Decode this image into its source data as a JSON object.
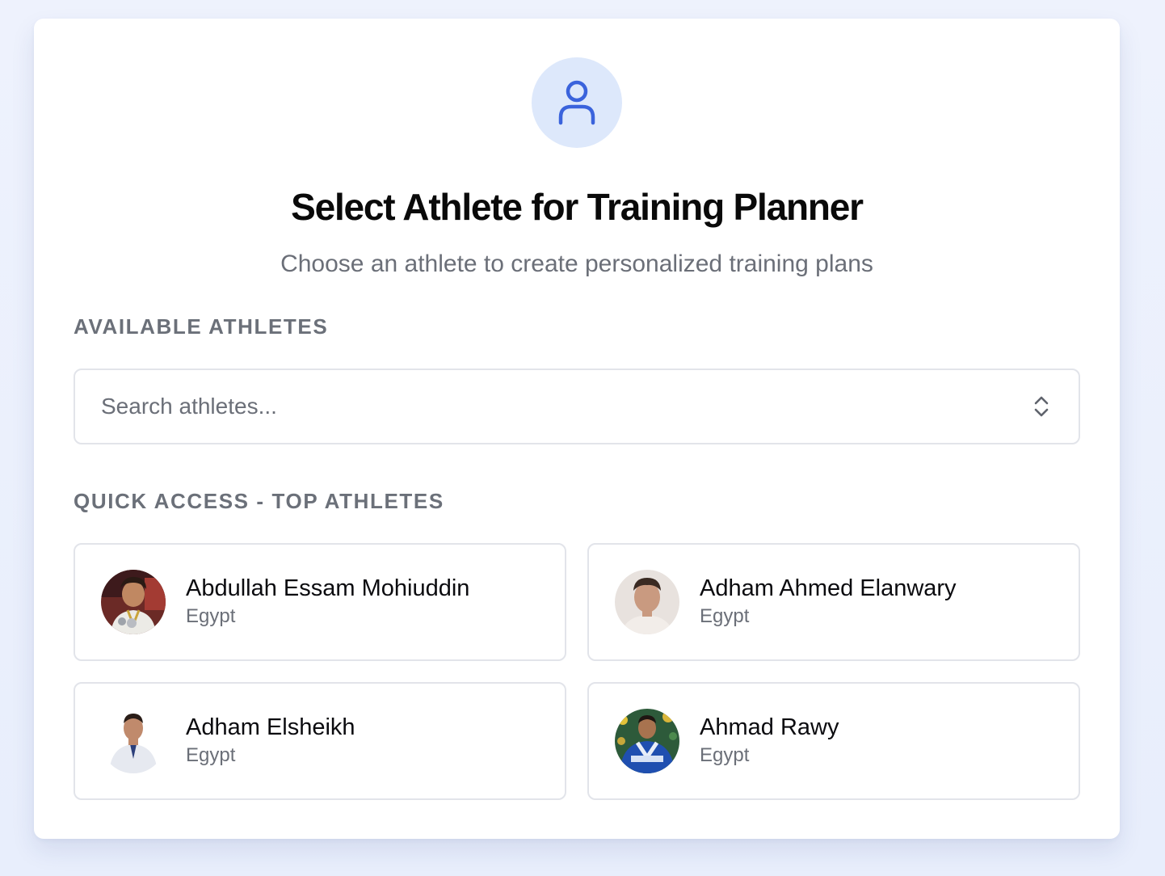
{
  "header": {
    "icon": "user-icon",
    "title": "Select Athlete for Training Planner",
    "subtitle": "Choose an athlete to create personalized training plans"
  },
  "available": {
    "label": "AVAILABLE ATHLETES",
    "search_placeholder": "Search athletes...",
    "search_value": ""
  },
  "quick_access": {
    "label": "QUICK ACCESS - TOP ATHLETES",
    "athletes": [
      {
        "name": "Abdullah Essam Mohiuddin",
        "country": "Egypt"
      },
      {
        "name": "Adham Ahmed Elanwary",
        "country": "Egypt"
      },
      {
        "name": "Adham Elsheikh",
        "country": "Egypt"
      },
      {
        "name": "Ahmad Rawy",
        "country": "Egypt"
      }
    ]
  },
  "colors": {
    "accent": "#3a63dc",
    "accent_bg": "#dde8fb",
    "muted_text": "#6b6f78",
    "border": "#e2e4ea"
  }
}
